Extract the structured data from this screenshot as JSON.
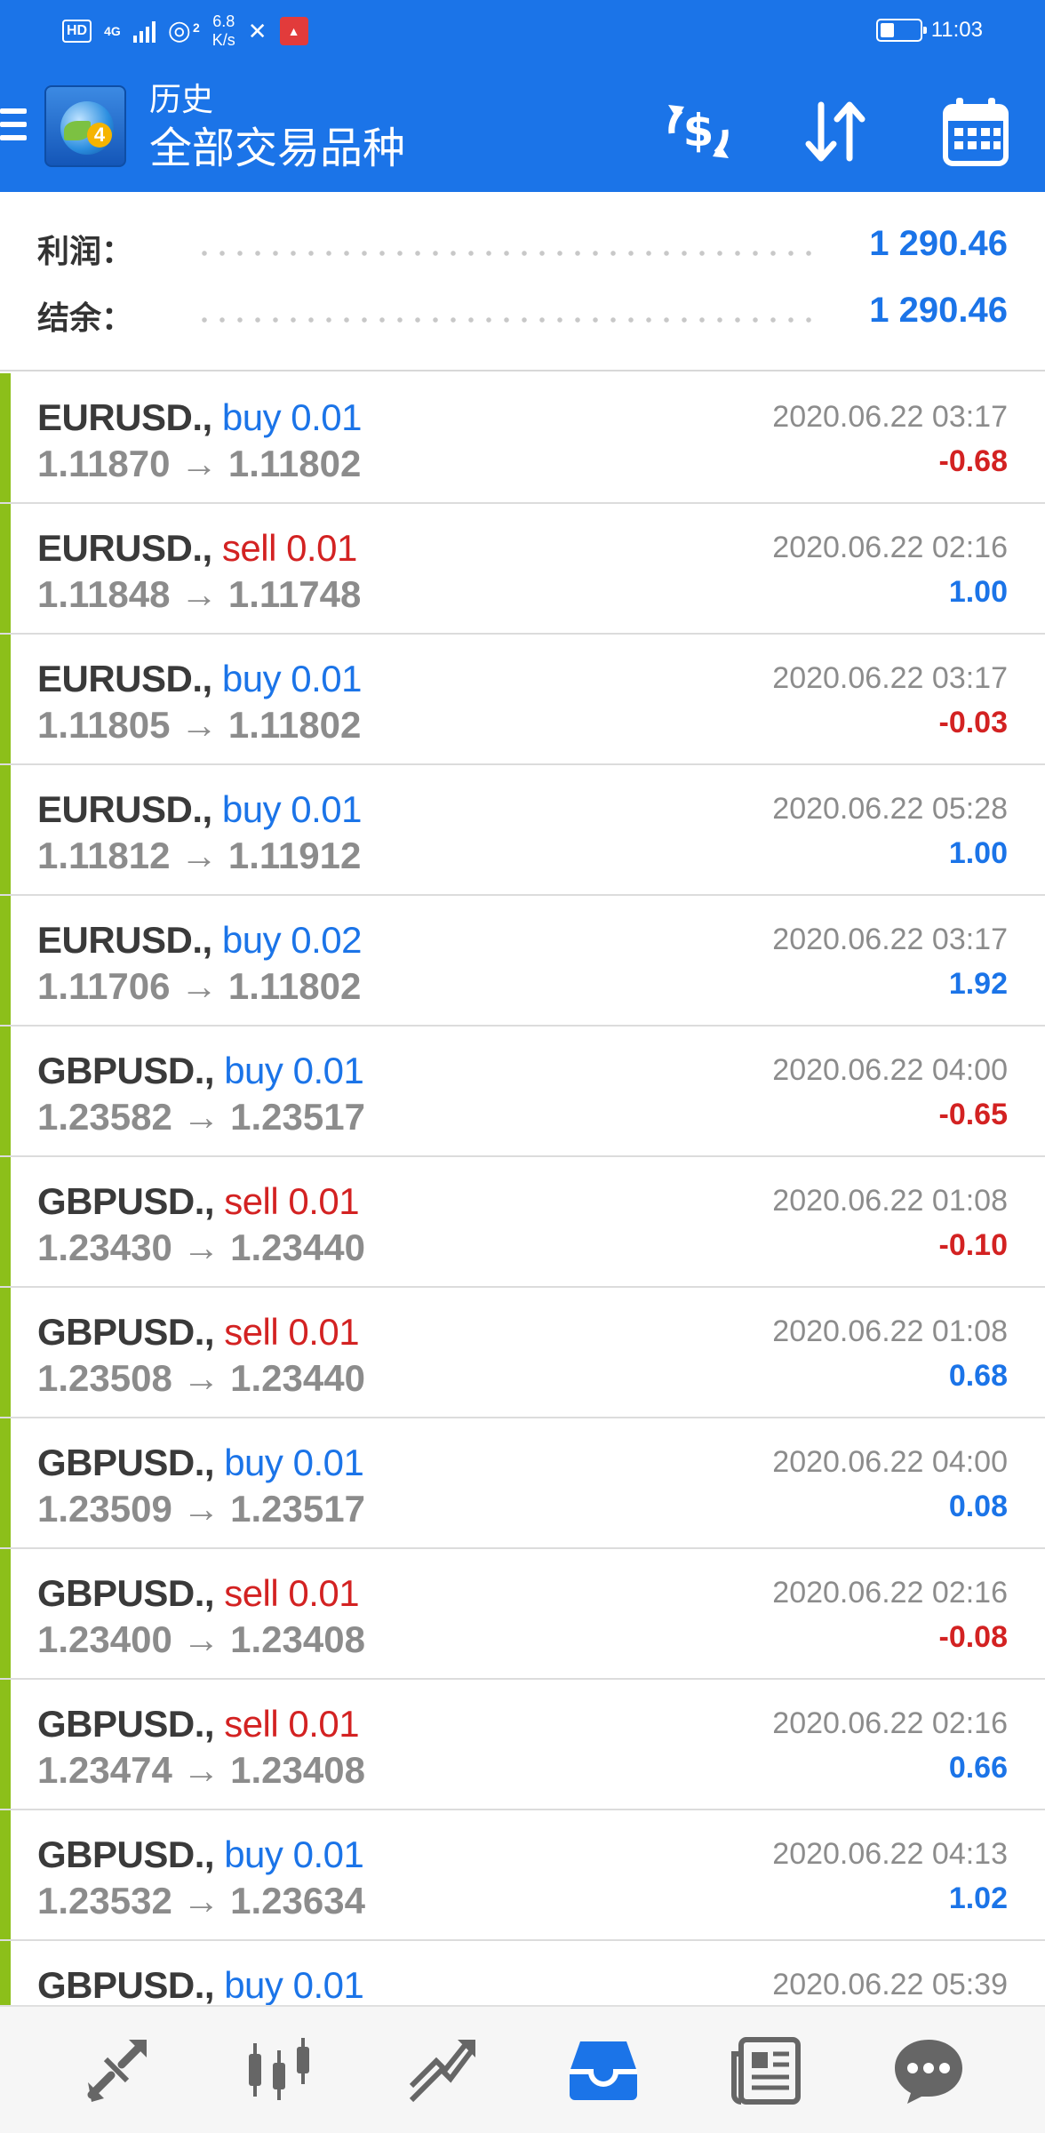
{
  "status_bar": {
    "hd": "HD",
    "network": "4G",
    "wifi_num": "2",
    "speed_value": "6.8",
    "speed_unit": "K/s",
    "time": "11:03",
    "battery_level": 0.35
  },
  "header": {
    "title_small": "历史",
    "title_big": "全部交易品种",
    "icons": [
      "currency-exchange-icon",
      "sort-icon",
      "calendar-icon"
    ]
  },
  "summary": {
    "profit_label": "利润：",
    "profit_value": "1 290.46",
    "balance_label": "结余：",
    "balance_value": "1 290.46"
  },
  "trades": [
    {
      "symbol": "EURUSD.,",
      "type": "buy 0.01",
      "side": "buy",
      "prices": "1.11870 → 1.11802",
      "time": "2020.06.22 03:17",
      "profit": "-0.68",
      "profit_sign": "neg"
    },
    {
      "symbol": "EURUSD.,",
      "type": "sell 0.01",
      "side": "sell",
      "prices": "1.11848 → 1.11748",
      "time": "2020.06.22 02:16",
      "profit": "1.00",
      "profit_sign": "pos"
    },
    {
      "symbol": "EURUSD.,",
      "type": "buy 0.01",
      "side": "buy",
      "prices": "1.11805 → 1.11802",
      "time": "2020.06.22 03:17",
      "profit": "-0.03",
      "profit_sign": "neg"
    },
    {
      "symbol": "EURUSD.,",
      "type": "buy 0.01",
      "side": "buy",
      "prices": "1.11812 → 1.11912",
      "time": "2020.06.22 05:28",
      "profit": "1.00",
      "profit_sign": "pos"
    },
    {
      "symbol": "EURUSD.,",
      "type": "buy 0.02",
      "side": "buy",
      "prices": "1.11706 → 1.11802",
      "time": "2020.06.22 03:17",
      "profit": "1.92",
      "profit_sign": "pos"
    },
    {
      "symbol": "GBPUSD.,",
      "type": "buy 0.01",
      "side": "buy",
      "prices": "1.23582 → 1.23517",
      "time": "2020.06.22 04:00",
      "profit": "-0.65",
      "profit_sign": "neg"
    },
    {
      "symbol": "GBPUSD.,",
      "type": "sell 0.01",
      "side": "sell",
      "prices": "1.23430 → 1.23440",
      "time": "2020.06.22 01:08",
      "profit": "-0.10",
      "profit_sign": "neg"
    },
    {
      "symbol": "GBPUSD.,",
      "type": "sell 0.01",
      "side": "sell",
      "prices": "1.23508 → 1.23440",
      "time": "2020.06.22 01:08",
      "profit": "0.68",
      "profit_sign": "pos"
    },
    {
      "symbol": "GBPUSD.,",
      "type": "buy 0.01",
      "side": "buy",
      "prices": "1.23509 → 1.23517",
      "time": "2020.06.22 04:00",
      "profit": "0.08",
      "profit_sign": "pos"
    },
    {
      "symbol": "GBPUSD.,",
      "type": "sell 0.01",
      "side": "sell",
      "prices": "1.23400 → 1.23408",
      "time": "2020.06.22 02:16",
      "profit": "-0.08",
      "profit_sign": "neg"
    },
    {
      "symbol": "GBPUSD.,",
      "type": "sell 0.01",
      "side": "sell",
      "prices": "1.23474 → 1.23408",
      "time": "2020.06.22 02:16",
      "profit": "0.66",
      "profit_sign": "pos"
    },
    {
      "symbol": "GBPUSD.,",
      "type": "buy 0.01",
      "side": "buy",
      "prices": "1.23532 → 1.23634",
      "time": "2020.06.22 04:13",
      "profit": "1.02",
      "profit_sign": "pos"
    },
    {
      "symbol": "GBPUSD.,",
      "type": "buy 0.01",
      "side": "buy",
      "prices": "",
      "time": "2020.06.22 05:39",
      "profit": "",
      "profit_sign": "pos"
    }
  ],
  "bottom_nav": {
    "items": [
      "quotes-icon",
      "chart-icon",
      "trade-icon",
      "history-icon",
      "news-icon",
      "chat-icon"
    ],
    "active": "history-icon"
  },
  "colors": {
    "primary": "#1b74e8",
    "buy": "#1b74e8",
    "sell": "#d32222",
    "row_marker": "#8cbf1a"
  }
}
